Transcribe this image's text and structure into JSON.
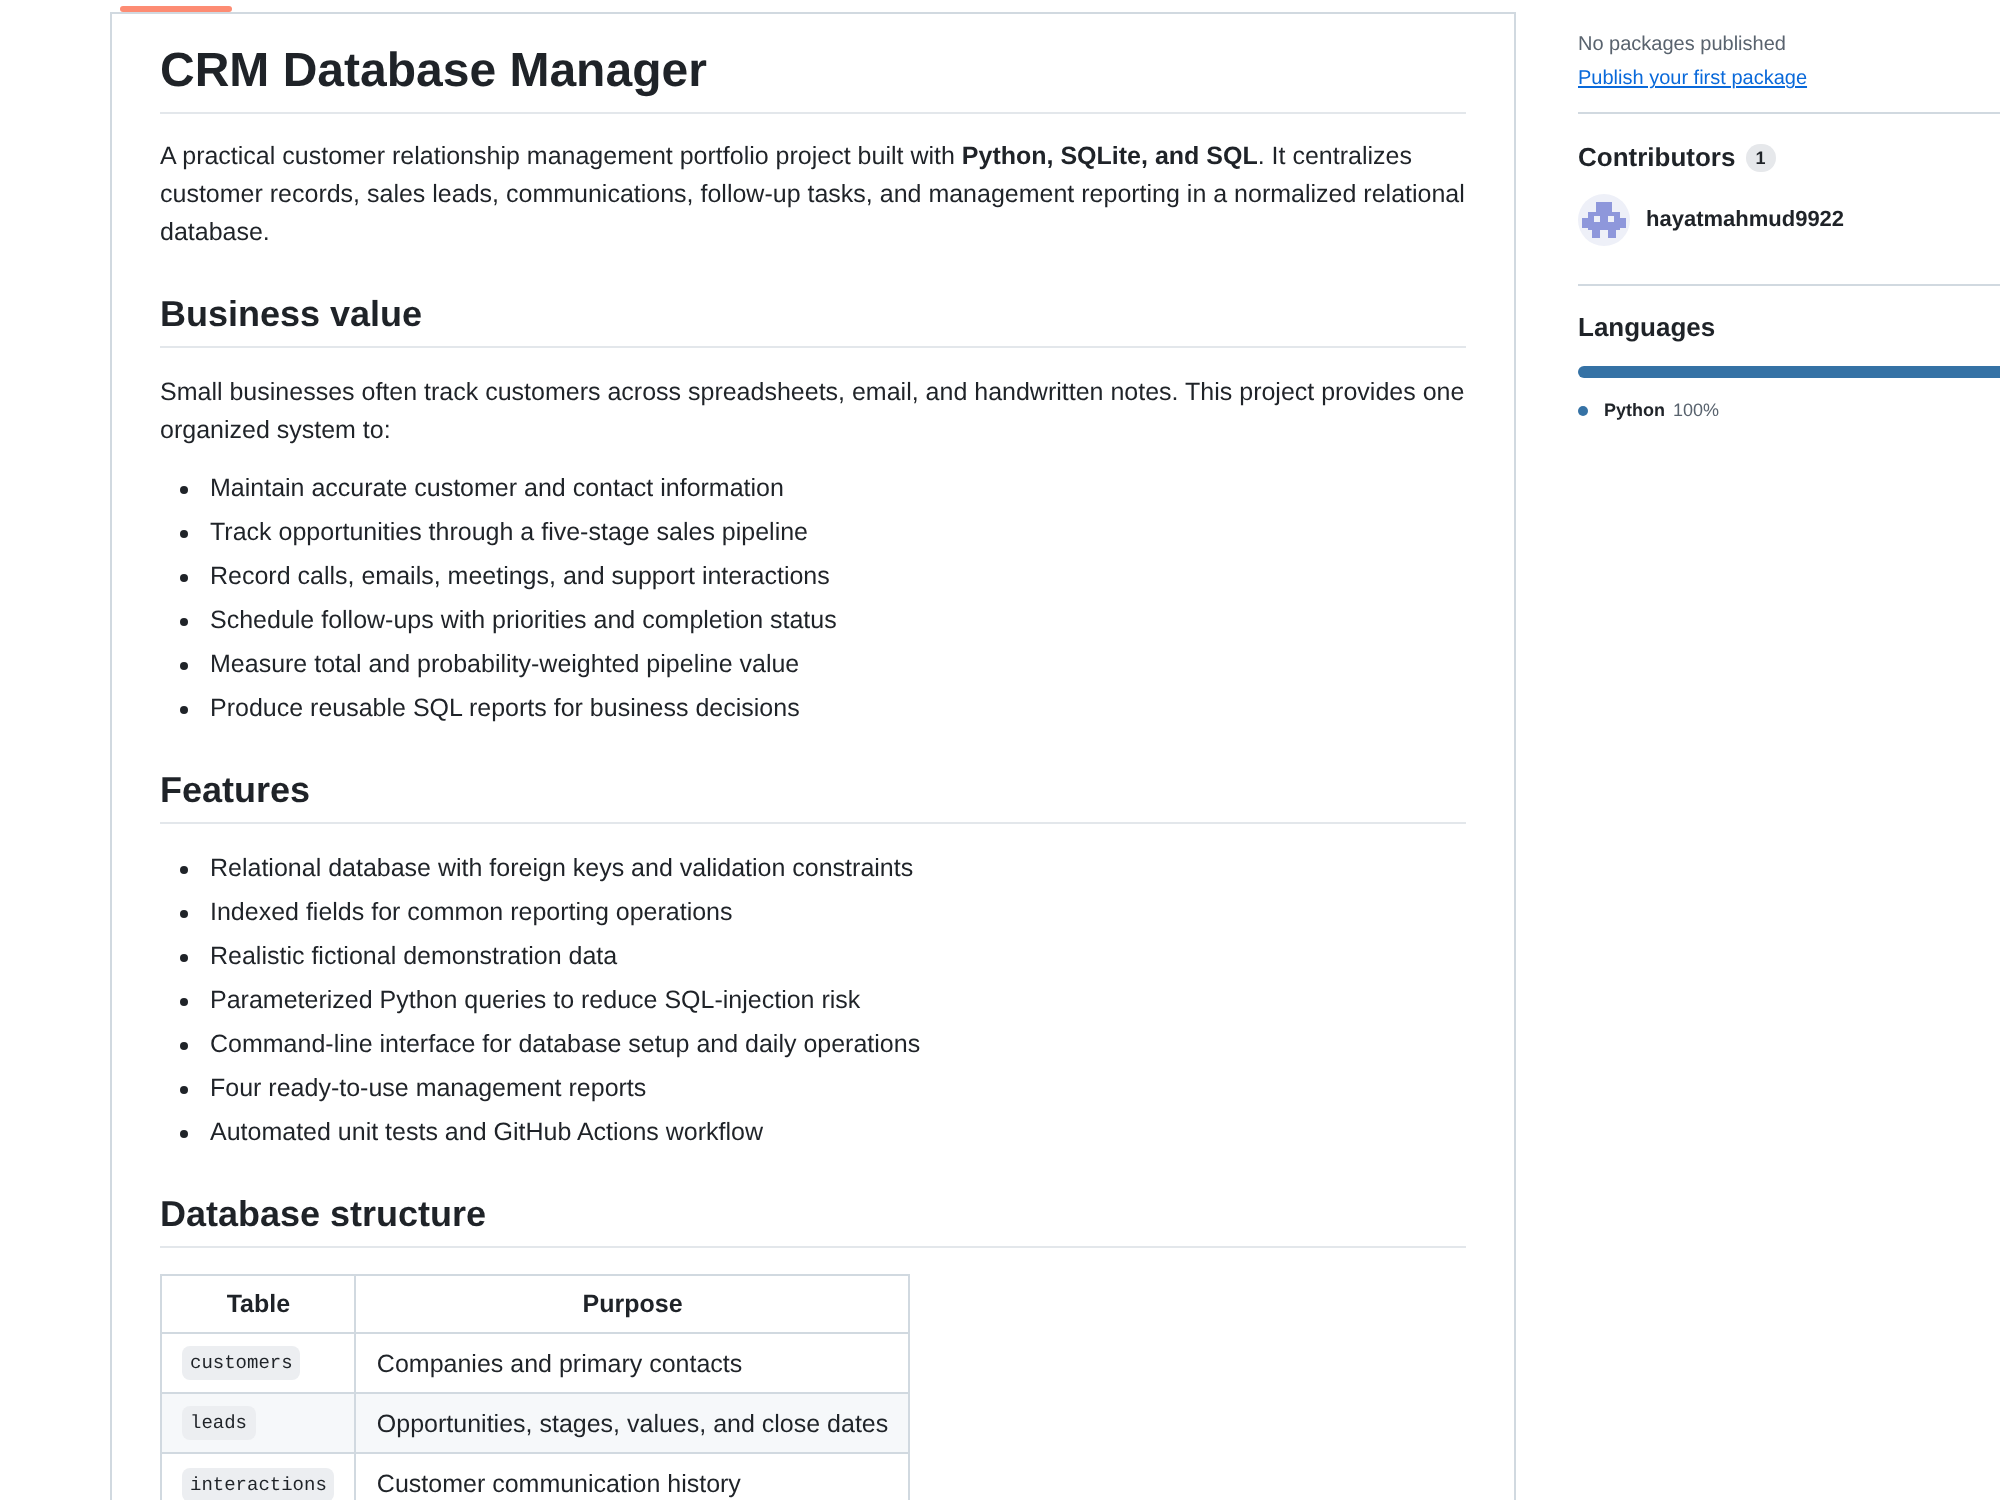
{
  "readme": {
    "title": "CRM Database Manager",
    "blocks": [
      {
        "kind": "paragraph",
        "text": "A practical customer relationship management portfolio project built with **Python, SQLite, and SQL**. It centralizes customer records, sales leads, communications, follow-up tasks, and management reporting in a normalized relational database."
      },
      {
        "kind": "heading",
        "text": "Business value"
      },
      {
        "kind": "paragraph",
        "text": "Small businesses often track customers across spreadsheets, email, and handwritten notes. This project provides one organized system to:"
      },
      {
        "kind": "list",
        "items": [
          "Maintain accurate customer and contact information",
          "Track opportunities through a five-stage sales pipeline",
          "Record calls, emails, meetings, and support interactions",
          "Schedule follow-ups with priorities and completion status",
          "Measure total and probability-weighted pipeline value",
          "Produce reusable SQL reports for business decisions"
        ]
      },
      {
        "kind": "heading",
        "text": "Features"
      },
      {
        "kind": "list",
        "items": [
          "Relational database with foreign keys and validation constraints",
          "Indexed fields for common reporting operations",
          "Realistic fictional demonstration data",
          "Parameterized Python queries to reduce SQL-injection risk",
          "Command-line interface for database setup and daily operations",
          "Four ready-to-use management reports",
          "Automated unit tests and GitHub Actions workflow"
        ]
      },
      {
        "kind": "heading",
        "text": "Database structure"
      },
      {
        "kind": "table",
        "columns": [
          "Table",
          "Purpose"
        ],
        "rows": [
          [
            "customers",
            "Companies and primary contacts"
          ],
          [
            "leads",
            "Opportunities, stages, values, and close dates"
          ],
          [
            "interactions",
            "Customer communication history"
          ]
        ]
      }
    ]
  },
  "sidebar": {
    "packages": {
      "note": "No packages published",
      "link": "Publish your first package"
    },
    "contributors": {
      "heading": "Contributors",
      "count": "1",
      "people": [
        {
          "name": "hayatmahmud9922"
        }
      ]
    },
    "languages": {
      "heading": "Languages",
      "items": [
        {
          "name": "Python",
          "percent": "100%",
          "color": "#3572a5",
          "level": 1
        }
      ]
    }
  }
}
